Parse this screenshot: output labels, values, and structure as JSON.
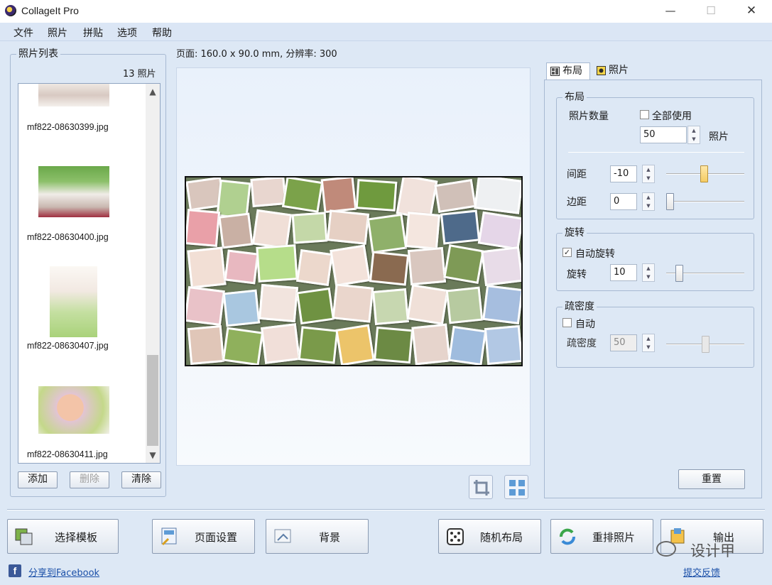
{
  "window": {
    "title": "CollageIt Pro",
    "minimize": "—",
    "maximize": "☐",
    "close": "✕"
  },
  "menu": [
    "文件",
    "照片",
    "拼贴",
    "选项",
    "帮助"
  ],
  "photo_list": {
    "title": "照片列表",
    "count": "13 照片",
    "items": [
      {
        "name": "mf822-08630399.jpg"
      },
      {
        "name": "mf822-08630400.jpg"
      },
      {
        "name": "mf822-08630407.jpg"
      },
      {
        "name": "mf822-08630411.jpg"
      }
    ],
    "scroll_up": "▲",
    "scroll_down": "▼",
    "add_label": "添加",
    "delete_label": "删除",
    "clear_label": "清除"
  },
  "page_info": "页面: 160.0 x 90.0 mm, 分辨率: 300",
  "right_panel": {
    "tabs": {
      "layout": "布局",
      "photo": "照片"
    },
    "layout_group": {
      "title": "布局",
      "photo_count_label": "照片数量",
      "use_all_label": "全部使用",
      "use_all_checked": false,
      "photo_count_value": "50",
      "photo_unit": "照片",
      "spacing_label": "间距",
      "spacing_value": "-10",
      "spacing_slider": 0.48,
      "margin_label": "边距",
      "margin_value": "0",
      "margin_slider": 0.0
    },
    "rotation_group": {
      "title": "旋转",
      "auto_label": "自动旋转",
      "auto_checked": true,
      "check_mark": "✓",
      "rotation_label": "旋转",
      "rotation_value": "10",
      "rotation_slider": 0.13
    },
    "density_group": {
      "title": "疏密度",
      "auto_label": "自动",
      "auto_checked": false,
      "density_label": "疏密度",
      "density_value": "50",
      "density_slider": 0.5
    },
    "reset_label": "重置"
  },
  "bottom": {
    "choose_template": "选择模板",
    "page_setup": "页面设置",
    "background": "背景",
    "random_layout": "随机布局",
    "reshuffle": "重排照片",
    "output": "输出",
    "share_facebook": "分享到Facebook",
    "feedback": "提交反馈",
    "facebook_letter": "f",
    "watermark": "设计甲"
  },
  "colors": {
    "accent": "#dde8f5",
    "link": "#1a4fa8",
    "slider_active": "#f5cc64"
  }
}
